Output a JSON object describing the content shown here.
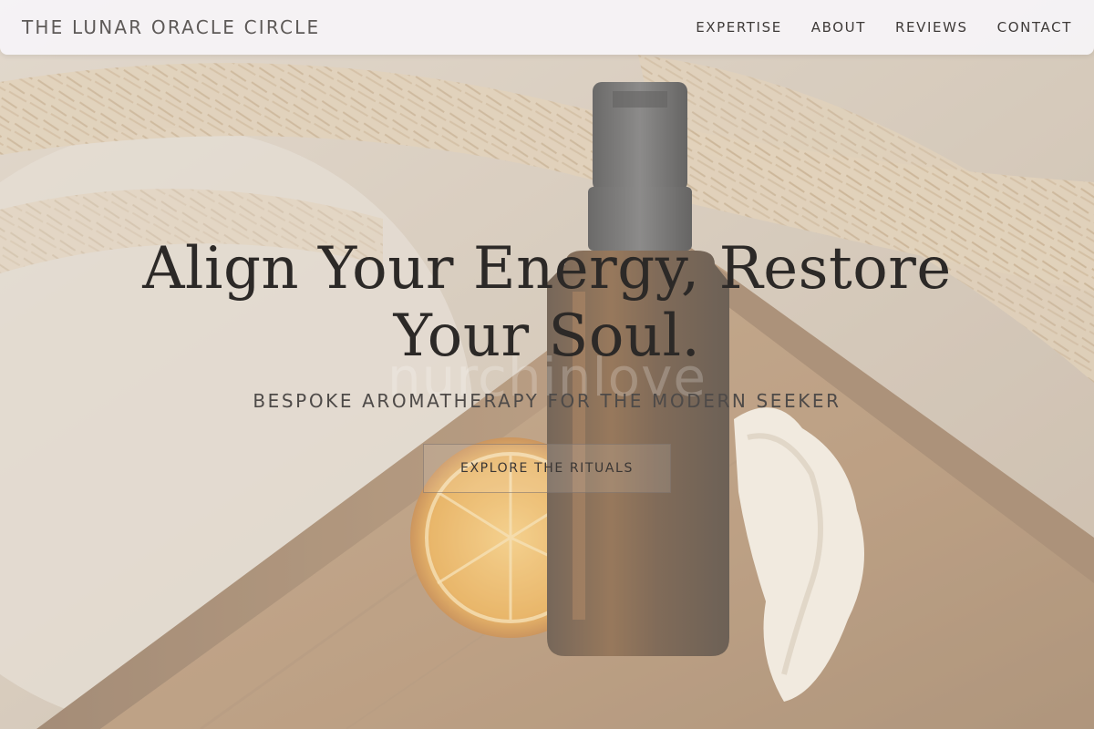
{
  "header": {
    "brand": "THE LUNAR ORACLE CIRCLE",
    "nav": [
      {
        "label": "EXPERTISE"
      },
      {
        "label": "ABOUT"
      },
      {
        "label": "REVIEWS"
      },
      {
        "label": "CONTACT"
      }
    ]
  },
  "hero": {
    "title_line1": "Align Your Energy, Restore",
    "title_line2": "Your Soul.",
    "subtitle": "BESPOKE AROMATHERAPY FOR THE MODERN SEEKER",
    "cta_label": "EXPLORE THE RITUALS",
    "watermark": "nurchinlove"
  },
  "colors": {
    "header_bg": "#f6f4f8",
    "title_text": "#2c2927",
    "nav_text": "#3f3b39",
    "brand_text": "#5e5a58"
  }
}
